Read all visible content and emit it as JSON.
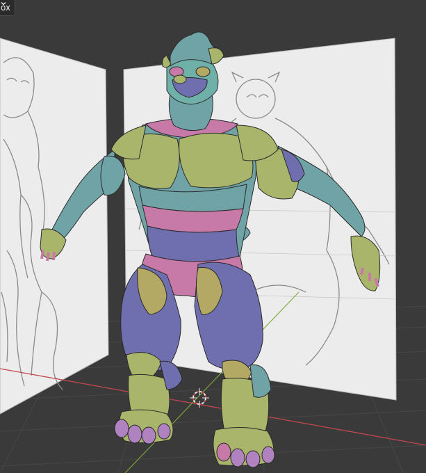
{
  "header": {
    "mode_label": "ox",
    "dropdown_icon": "chevron-down-icon"
  },
  "viewport": {
    "background": "#3a3a3a",
    "grid_color": "#444444",
    "x_axis_color": "#c0474f",
    "y_axis_color": "#7fa83a",
    "reference_images": [
      "left-sketch-reference",
      "right-sketch-reference"
    ],
    "model": "bear-character-sculpt",
    "cursor_icon": "3d-cursor-icon"
  },
  "palette": {
    "teal": "#6fa3a6",
    "green": "#a9b56a",
    "pink": "#c77aa8",
    "purple": "#6f6fb0",
    "olive": "#b3a864",
    "head": "#6fb0a8",
    "claw": "#b083c0"
  }
}
